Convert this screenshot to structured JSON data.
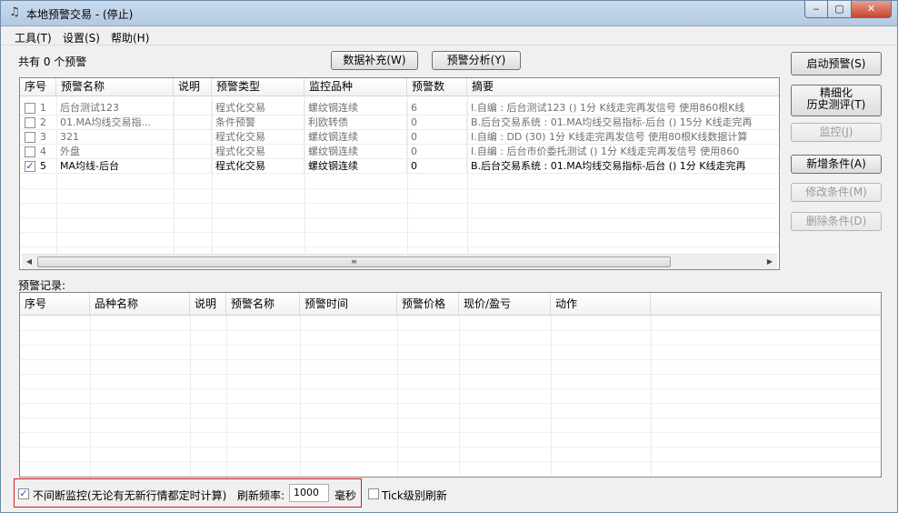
{
  "window": {
    "title": "本地预警交易 - (停止)",
    "icon": "bell-icon"
  },
  "menu": [
    {
      "label": "工具(T)"
    },
    {
      "label": "设置(S)"
    },
    {
      "label": "帮助(H)"
    }
  ],
  "summary": "共有 0 个预警",
  "toolbar": {
    "fill_data": "数据补充(W)",
    "analysis": "预警分析(Y)"
  },
  "alerts_table": {
    "columns": [
      "序号",
      "预警名称",
      "说明",
      "预警类型",
      "监控品种",
      "预警数",
      "摘要"
    ],
    "rows": [
      {
        "checked": false,
        "id": "1",
        "name": "后台测试123",
        "desc": "",
        "type": "程式化交易",
        "symbol": "螺纹钢连续",
        "count": "6",
        "summary": "I.自编 : 后台测试123 () 1分 K线走完再发信号 使用860根K线"
      },
      {
        "checked": false,
        "id": "2",
        "name": "01.MA均线交易指...",
        "desc": "",
        "type": "条件预警",
        "symbol": "利欧转债",
        "count": "0",
        "summary": "B.后台交易系统 : 01.MA均线交易指标-后台 () 15分 K线走完再"
      },
      {
        "checked": false,
        "id": "3",
        "name": "321",
        "desc": "",
        "type": "程式化交易",
        "symbol": "螺纹钢连续",
        "count": "0",
        "summary": "I.自编 : DD (30) 1分 K线走完再发信号 使用80根K线数据计算"
      },
      {
        "checked": false,
        "id": "4",
        "name": "外盘",
        "desc": "",
        "type": "程式化交易",
        "symbol": "螺纹钢连续",
        "count": "0",
        "summary": "I.自编 : 后台市价委托测试 () 1分 K线走完再发信号 使用860"
      },
      {
        "checked": true,
        "id": "5",
        "name": "MA均线-后台",
        "desc": "",
        "type": "程式化交易",
        "symbol": "螺纹钢连续",
        "count": "0",
        "summary": "B.后台交易系统 : 01.MA均线交易指标-后台 () 1分 K线走完再"
      }
    ]
  },
  "side_buttons": {
    "start": "启动预警(S)",
    "refine_line1": "精细化",
    "refine_line2": "历史测评(T)",
    "monitor": "监控(J)",
    "add": "新增条件(A)",
    "edit": "修改条件(M)",
    "delete": "删除条件(D)"
  },
  "records_label": "预警记录:",
  "records_table": {
    "columns": [
      "序号",
      "品种名称",
      "说明",
      "预警名称",
      "预警时间",
      "预警价格",
      "现价/盈亏",
      "动作"
    ]
  },
  "footer": {
    "continuous_checked": true,
    "continuous_label": "不间断监控(无论有无新行情都定时计算)",
    "refresh_label": "刷新频率:",
    "refresh_value": "1000",
    "unit": "毫秒",
    "tick_checked": false,
    "tick_label": "Tick级别刷新"
  }
}
